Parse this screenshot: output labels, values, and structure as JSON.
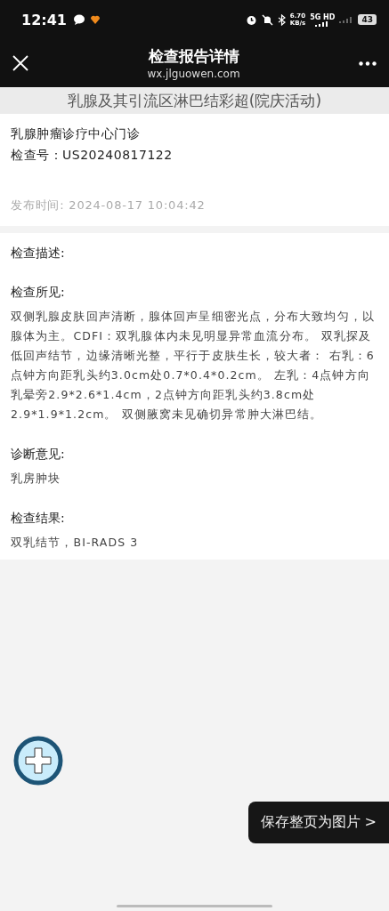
{
  "status_bar": {
    "time": "12:41",
    "speed_value": "6.70",
    "speed_unit": "KB/s",
    "network": "5G HD",
    "battery": "43"
  },
  "nav": {
    "title": "检查报告详情",
    "subtitle": "wx.jlguowen.com"
  },
  "report": {
    "title": "乳腺及其引流区淋巴结彩超(院庆活动)",
    "department": "乳腺肿瘤诊疗中心门诊",
    "exam_number": "检查号：US20240817122",
    "published": "发布时间:  2024-08-17 10:04:42"
  },
  "sections": [
    {
      "heading": "检查描述:"
    },
    {
      "heading": "检查所见:",
      "body": "双侧乳腺皮肤回声清断，腺体回声呈细密光点，分布大致均匀，以腺体为主。CDFI：双乳腺体内未见明显异常血流分布。 双乳探及低回声结节，边缘清晰光整，平行于皮肤生长，较大者： 右乳：6点钟方向距乳头约3.0cm处0.7*0.4*0.2cm。 左乳：4点钟方向乳晕旁2.9*2.6*1.4cm，2点钟方向距乳头约3.8cm处2.9*1.9*1.2cm。 双侧腋窝未见确切异常肿大淋巴结。"
    },
    {
      "heading": "诊断意见:",
      "body": "乳房肿块"
    },
    {
      "heading": "检查结果:",
      "body": "双乳结节，BI-RADS 3"
    }
  ],
  "save_button": "保存整页为图片 >"
}
